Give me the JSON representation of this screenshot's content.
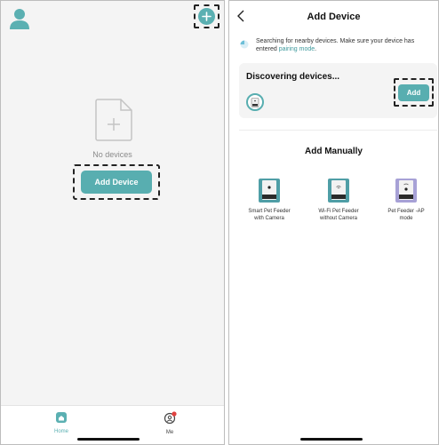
{
  "left_screen": {
    "empty_text": "No devices",
    "add_device_label": "Add Device",
    "tabs": [
      {
        "label": "Home",
        "icon": "home-icon",
        "active": true
      },
      {
        "label": "Me",
        "icon": "profile-icon",
        "active": false,
        "notification_dot": true
      }
    ]
  },
  "right_screen": {
    "title": "Add Device",
    "search_text": "Searching for nearby devices. Make sure your device has entered ",
    "search_link": "pairing mode",
    "search_suffix": ".",
    "discovering_title": "Discovering devices...",
    "add_label": "Add",
    "manual_title": "Add Manually",
    "products": [
      {
        "name_line1": "Smart Pet Feeder",
        "name_line2": "with Camera",
        "icon": "pet-feeder-camera-icon"
      },
      {
        "name_line1": "Wi-Fi Pet Feeder",
        "name_line2": "without Camera",
        "icon": "pet-feeder-wifi-icon"
      },
      {
        "name_line1": "Pet Feeder -AP",
        "name_line2": "mode",
        "icon": "pet-feeder-ap-icon"
      }
    ]
  },
  "colors": {
    "accent": "#58aeb0",
    "link": "#3f9a9d",
    "background": "#f4f4f4",
    "notification": "#e0413f"
  }
}
